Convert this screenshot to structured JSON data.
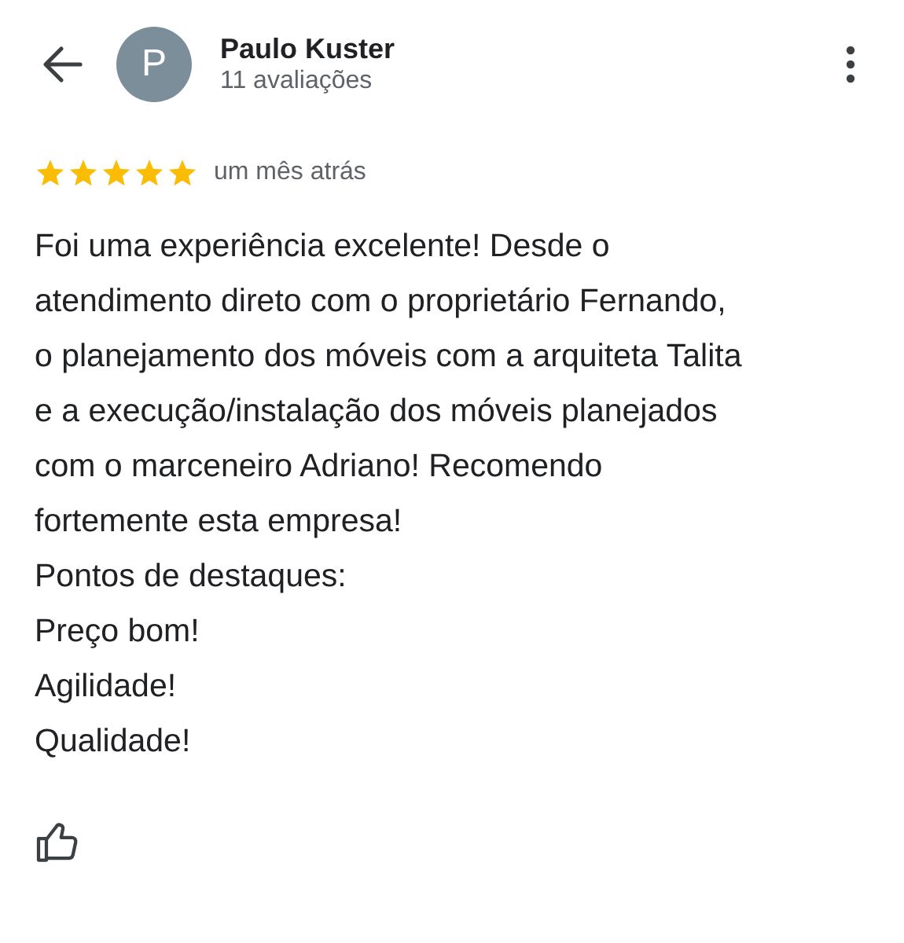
{
  "header": {
    "avatar_letter": "P",
    "name": "Paulo Kuster",
    "subtitle": "11 avaliações"
  },
  "review": {
    "stars": 5,
    "time": "um mês atrás",
    "text": "Foi uma experiência excelente! Desde o\natendimento direto com o proprietário Fernando,\no planejamento dos móveis com a arquiteta Talita\ne a execução/instalação dos móveis planejados\ncom o marceneiro Adriano! Recomendo\nfortemente esta empresa!\nPontos de destaques:\nPreço bom!\nAgilidade!\nQualidade!"
  }
}
